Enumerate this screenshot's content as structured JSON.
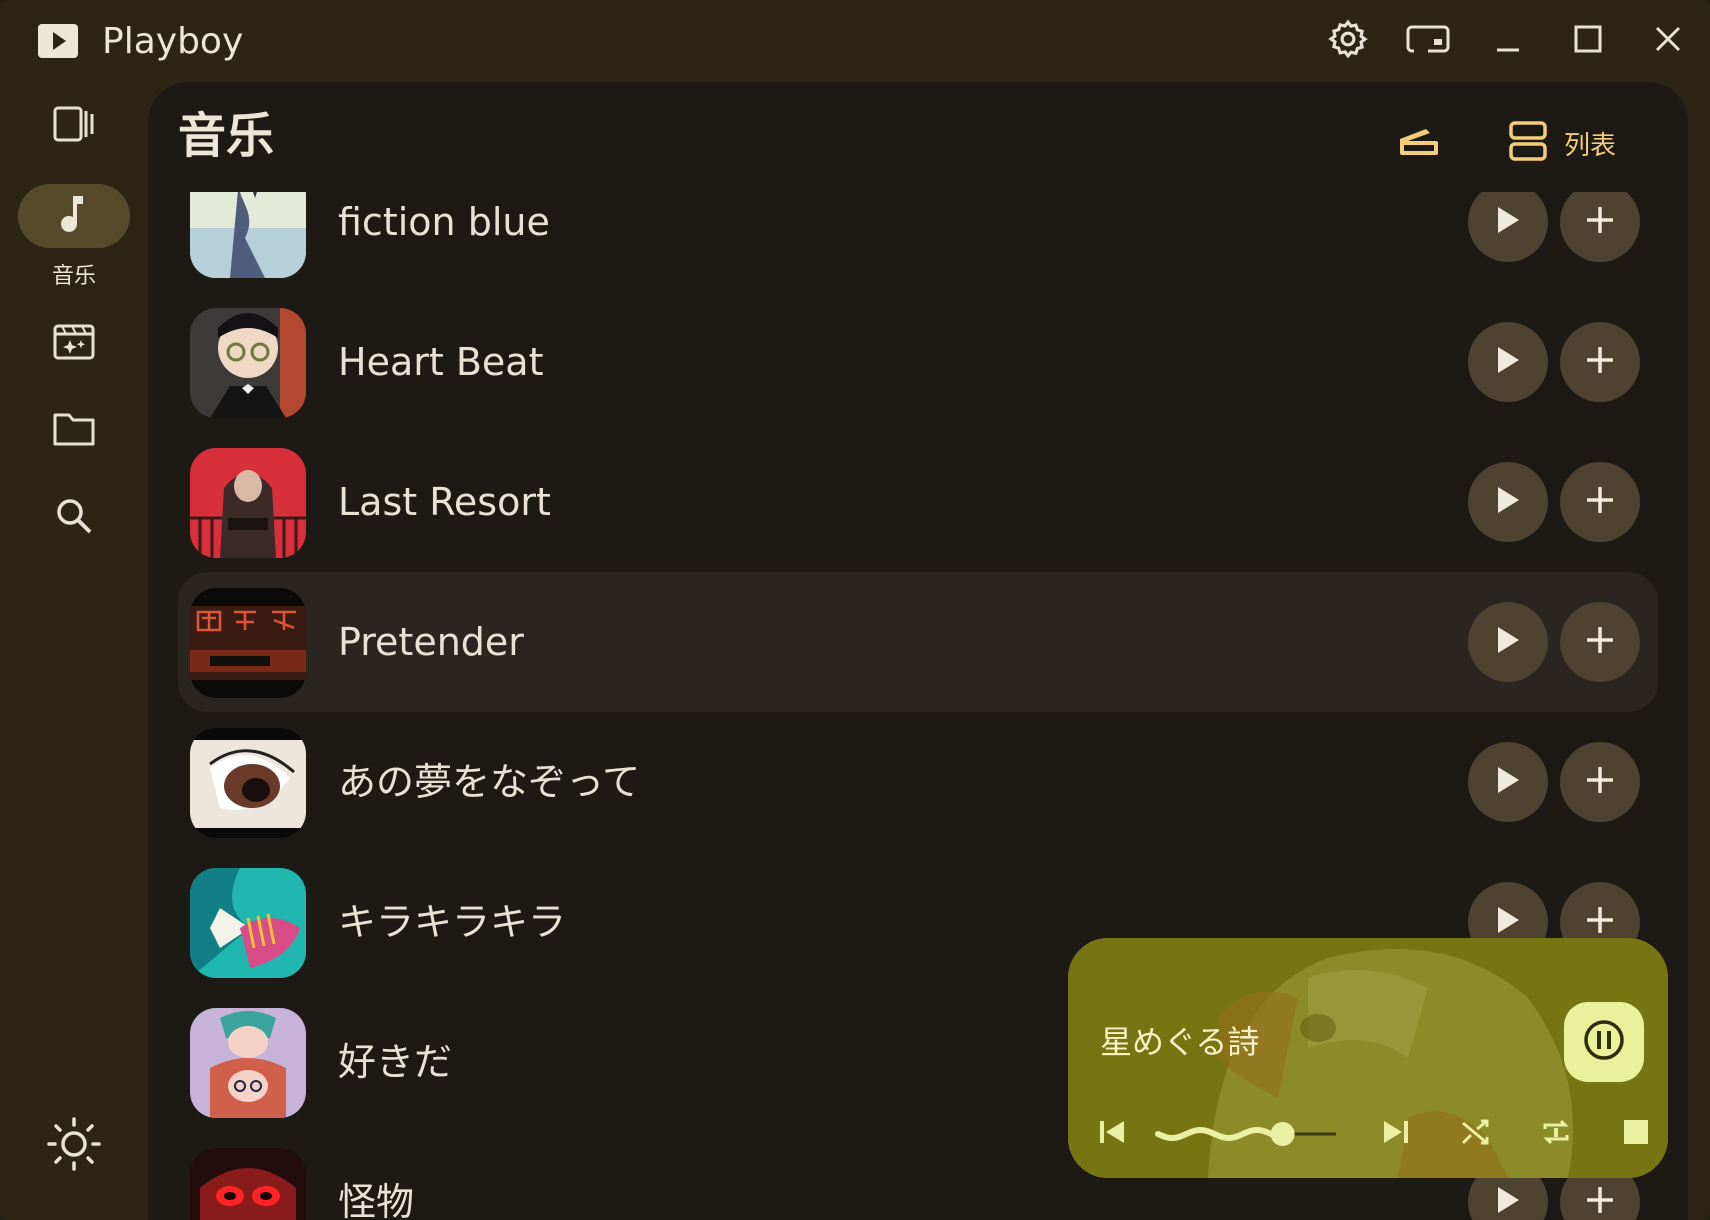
{
  "window": {
    "title": "Playboy"
  },
  "sidebar": {
    "items": [
      {
        "icon": "now-playing-icon"
      },
      {
        "icon": "music-note-icon",
        "label": "音乐",
        "active": true
      },
      {
        "icon": "video-icon"
      },
      {
        "icon": "folder-icon"
      },
      {
        "icon": "search-icon"
      }
    ],
    "theme_icon": "brightness-icon"
  },
  "header": {
    "title": "音乐",
    "sort_icon": "sort-icon",
    "view_label": "列表",
    "view_icon": "list-view-icon"
  },
  "songs": [
    {
      "title": "fiction blue"
    },
    {
      "title": "Heart Beat"
    },
    {
      "title": "Last Resort"
    },
    {
      "title": "Pretender",
      "highlighted": true
    },
    {
      "title": "あの夢をなぞって"
    },
    {
      "title": "キラキラキラ"
    },
    {
      "title": "好きだ"
    },
    {
      "title": "怪物"
    }
  ],
  "player": {
    "title": "星めぐる詩",
    "progress": 0.7,
    "state": "playing"
  },
  "colors": {
    "accent": "#f5cd7a",
    "titlebar_bg": "#2c2514",
    "content_bg": "#1d1a15",
    "button_bg": "#4e4330",
    "player_bg": "#7d7a18"
  }
}
